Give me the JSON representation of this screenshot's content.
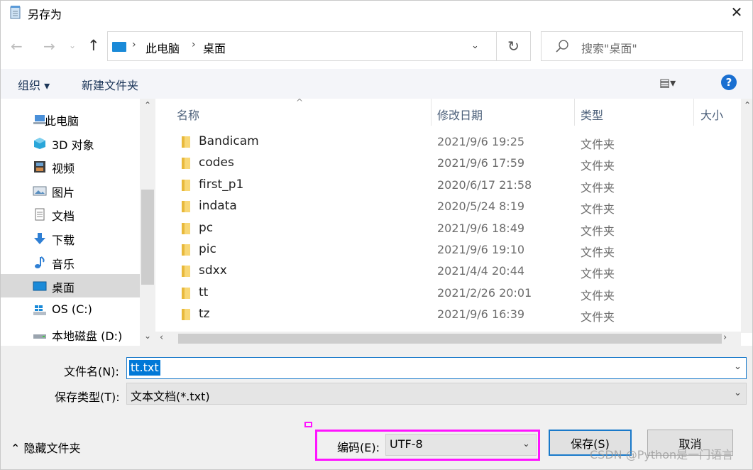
{
  "window": {
    "title": "另存为",
    "close_glyph": "✕"
  },
  "nav": {
    "back_glyph": "←",
    "forward_glyph": "→",
    "recent_glyph": "⌄",
    "up_glyph": "↑",
    "address": {
      "crumbs": [
        "此电脑",
        "桌面"
      ],
      "separator": "›",
      "dropdown_glyph": "⌄"
    },
    "refresh_glyph": "↻",
    "search_placeholder": "搜索\"桌面\""
  },
  "toolbar": {
    "organize_label": "组织 ▾",
    "new_folder_label": "新建文件夹",
    "view_label": "▤▾",
    "help_label": "?"
  },
  "sidebar": {
    "items": [
      {
        "label": "此电脑",
        "icon": "computer-icon",
        "selected": false
      },
      {
        "label": "3D 对象",
        "icon": "cube-3d-icon",
        "selected": false
      },
      {
        "label": "视频",
        "icon": "video-icon",
        "selected": false
      },
      {
        "label": "图片",
        "icon": "picture-icon",
        "selected": false
      },
      {
        "label": "文档",
        "icon": "document-icon",
        "selected": false
      },
      {
        "label": "下载",
        "icon": "download-icon",
        "selected": false
      },
      {
        "label": "音乐",
        "icon": "music-icon",
        "selected": false
      },
      {
        "label": "桌面",
        "icon": "desktop-icon",
        "selected": true
      },
      {
        "label": "OS (C:)",
        "icon": "windows-drive-icon",
        "selected": false
      },
      {
        "label": "本地磁盘 (D:)",
        "icon": "disk-drive-icon",
        "selected": false
      }
    ],
    "scroll_up": "⌃",
    "scroll_down": "⌄"
  },
  "columns": {
    "name": "名称",
    "modified": "修改日期",
    "type": "类型",
    "size": "大小",
    "sort_glyph": "^"
  },
  "files": [
    {
      "name": "Bandicam",
      "date": "2021/9/6 19:25",
      "type": "文件夹"
    },
    {
      "name": "codes",
      "date": "2021/9/6 17:59",
      "type": "文件夹"
    },
    {
      "name": "first_p1",
      "date": "2020/6/17 21:58",
      "type": "文件夹"
    },
    {
      "name": "indata",
      "date": "2020/5/24 8:19",
      "type": "文件夹"
    },
    {
      "name": "pc",
      "date": "2021/9/6 18:49",
      "type": "文件夹"
    },
    {
      "name": "pic",
      "date": "2021/9/6 19:10",
      "type": "文件夹"
    },
    {
      "name": "sdxx",
      "date": "2021/4/4 20:44",
      "type": "文件夹"
    },
    {
      "name": "tt",
      "date": "2021/2/26 20:01",
      "type": "文件夹"
    },
    {
      "name": "tz",
      "date": "2021/9/6 16:39",
      "type": "文件夹"
    }
  ],
  "scrollbars": {
    "up": "⌃",
    "left": "‹",
    "right": "›"
  },
  "form": {
    "filename_label": "文件名(N):",
    "filename_value": "tt.txt",
    "filetype_label": "保存类型(T):",
    "filetype_value": "文本文档(*.txt)",
    "encoding_label": "编码(E):",
    "encoding_value": "UTF-8",
    "dropdown_glyph": "⌄"
  },
  "footer": {
    "hide_folders_label": "⌃ 隐藏文件夹",
    "save_label": "保存(S)",
    "cancel_label": "取消",
    "watermark": "CSDN @Python是一门语言"
  },
  "colors": {
    "highlight": "#ff14ff",
    "accent": "#0078d7",
    "folder": "#f8d775"
  }
}
